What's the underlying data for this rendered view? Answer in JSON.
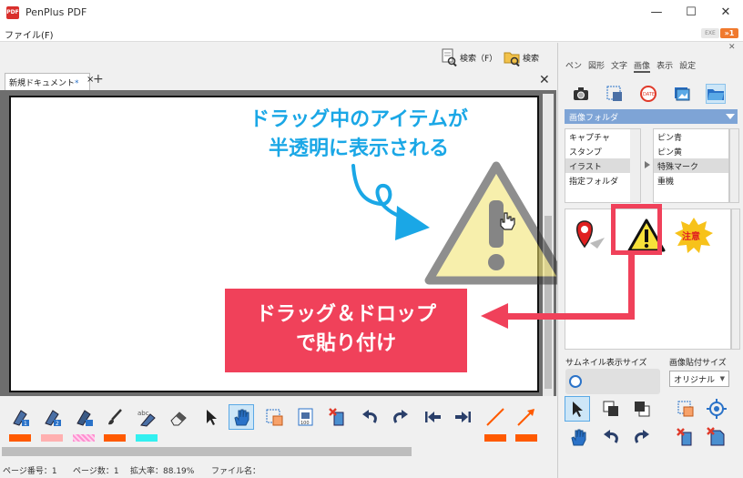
{
  "window": {
    "app_icon_text": "PDF",
    "title": "PenPlus PDF",
    "minimize": "—",
    "maximize": "☐",
    "close": "✕"
  },
  "menu": {
    "file": "ファイル(F)",
    "badge1": "EXE",
    "badge2": "»1"
  },
  "search": {
    "search1": "検索（F）",
    "search2": "検索"
  },
  "doc": {
    "tab_label": "新規ドキュメント",
    "tab_modified": "*",
    "tab_close": "×",
    "tab_add": "+",
    "close": "✕"
  },
  "annotations": {
    "callout_line1": "ドラッグ中のアイテムが",
    "callout_line2": "半透明に表示される",
    "dnd_line1": "ドラッグ＆ドロップ",
    "dnd_line2": "で貼り付け"
  },
  "right_panel": {
    "close": "✕",
    "tabs": [
      "ペン",
      "図形",
      "文字",
      "画像",
      "表示",
      "設定"
    ],
    "active_tab": 3,
    "folder_header": "画像フォルダ",
    "left_list": [
      "キャプチャ",
      "スタンプ",
      "イラスト",
      "指定フォルダ"
    ],
    "left_selected": 2,
    "right_list": [
      "ピン青",
      "ピン黄",
      "特殊マーク",
      "重機"
    ],
    "right_selected": 2,
    "thumb_label": "注意",
    "thumbnail_size_label": "サムネイル表示サイズ",
    "paste_size_label": "画像貼付サイズ",
    "paste_size_value": "オリジナル"
  },
  "status": {
    "page_number_label": "ページ番号：1",
    "page_count_label": "ページ数：1",
    "zoom_label": "拡大率：88.19%",
    "filename_label": "ファイル名："
  },
  "colors": {
    "accent_blue": "#1aa7e6",
    "accent_red": "#f0415a",
    "folder_header": "#7ea4d6",
    "swatch_orange": "#ff5a00",
    "swatch_pink": "#ffb0b0",
    "swatch_checker": "#ff8fd0",
    "swatch_cyan": "#33f0f0"
  }
}
